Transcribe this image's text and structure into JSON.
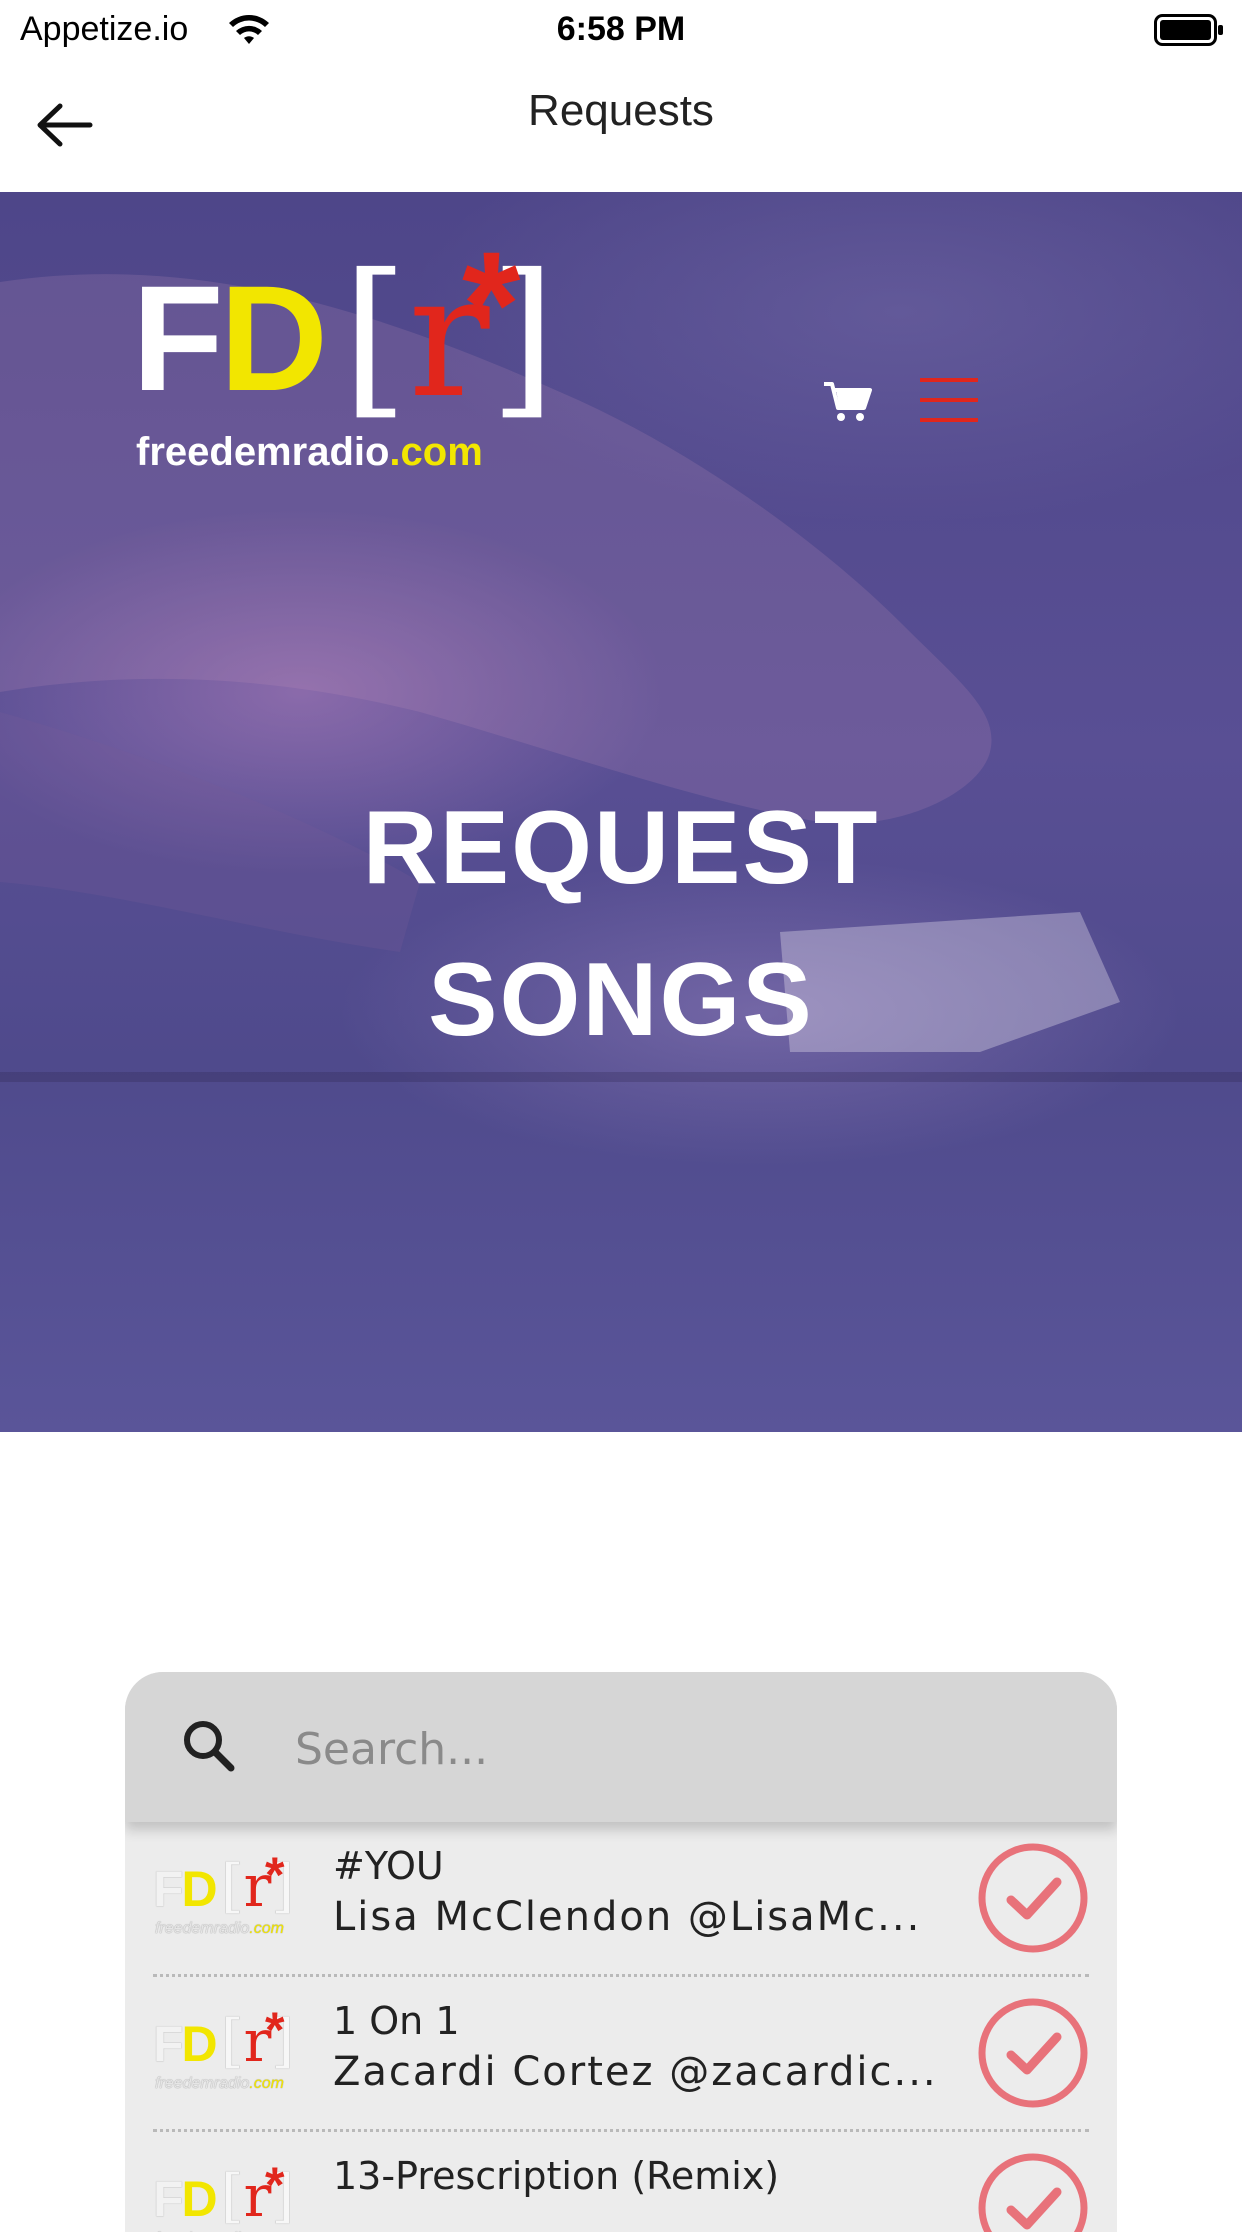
{
  "status_bar": {
    "carrier": "Appetize.io",
    "time": "6:58 PM",
    "icons": [
      "wifi-icon",
      "battery-icon"
    ]
  },
  "nav": {
    "title": "Requests",
    "back_icon": "arrow-left-icon"
  },
  "hero": {
    "logo": {
      "f": "F",
      "d": "D",
      "r_open": "[",
      "r": "r",
      "r_close": "]",
      "star": "*",
      "domain_main": "freedemradio",
      "domain_tld": ".com"
    },
    "title_line1": "REQUEST",
    "title_line2": "SONGS",
    "icons": [
      "cart-icon",
      "hamburger-menu-icon"
    ],
    "colors": {
      "overlay": "#4e4689",
      "logo_yellow": "#f2e600",
      "logo_red": "#e1261c"
    }
  },
  "search": {
    "placeholder": "Search...",
    "value": "",
    "icon": "search-icon"
  },
  "requests": [
    {
      "title": "#YOU",
      "artist": "Lisa McClendon @LisaMc..."
    },
    {
      "title": "1 On 1",
      "artist": "Zacardi Cortez @zacardic..."
    },
    {
      "title": "13-Prescription (Remix)",
      "artist": ""
    }
  ],
  "accent": {
    "check_color": "#e8727a",
    "card_bg": "#ececec",
    "search_bg": "#d6d6d6"
  }
}
